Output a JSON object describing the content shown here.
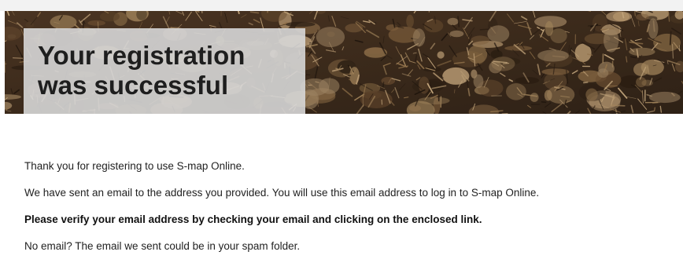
{
  "hero": {
    "title_line1": "Your registration",
    "title_line2": "was successful",
    "background_image": "soil-mulch-texture-photo"
  },
  "message": {
    "line1": "Thank you for registering to use S-map Online.",
    "line2": "We have sent an email to the address you provided. You will use this email address to log in to S-map Online.",
    "line3": "Please verify your email address by checking your email and clicking on the enclosed link.",
    "line4": "No email? The email we sent could be in your spam folder."
  },
  "colors": {
    "title_box": "#d7d7d7",
    "title_text": "#1e1e1e",
    "body_text": "#222222",
    "soil_dark": "#3a2a1c",
    "soil_light": "#b89a72"
  }
}
